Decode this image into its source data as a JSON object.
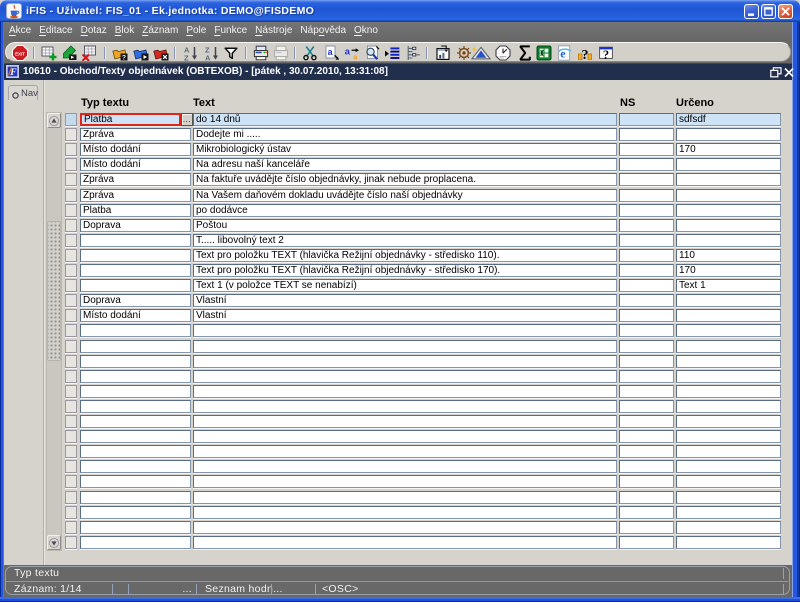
{
  "window": {
    "title": "iFIS - Uživatel: FIS_01 - Ek.jednotka: DEMO@FISDEMO",
    "controls": [
      "minimize",
      "maximize",
      "close"
    ]
  },
  "menu": {
    "items": [
      {
        "pre": "",
        "key": "A",
        "post": "kce"
      },
      {
        "pre": "",
        "key": "E",
        "post": "ditace"
      },
      {
        "pre": "",
        "key": "D",
        "post": "otaz"
      },
      {
        "pre": "",
        "key": "B",
        "post": "lok"
      },
      {
        "pre": "",
        "key": "Z",
        "post": "áznam"
      },
      {
        "pre": "",
        "key": "P",
        "post": "ole"
      },
      {
        "pre": "",
        "key": "F",
        "post": "unkce"
      },
      {
        "pre": "",
        "key": "N",
        "post": "ástroje"
      },
      {
        "pre": "Náp",
        "key": "o",
        "post": "věda"
      },
      {
        "pre": "",
        "key": "O",
        "post": "kno"
      }
    ]
  },
  "toolbar": {
    "exit_label": "EXIT",
    "icons": [
      "exit",
      "separator",
      "new-record",
      "save-record",
      "delete-record",
      "separator",
      "enter-query",
      "execute-query",
      "cancel-query",
      "separator",
      "sort-ascending",
      "sort-descending",
      "filter",
      "separator",
      "print",
      "print-preview",
      "separator",
      "cut",
      "copy",
      "paste",
      "find",
      "list-of-values",
      "tree",
      "separator",
      "window-navigator",
      "helm",
      "mountain",
      "clock",
      "sum",
      "excel-export",
      "web-browser",
      "item-help",
      "help"
    ]
  },
  "document_window": {
    "title": "10610 - Obchod/Texty objednávek (OBTEXOB) - [pátek , 30.07.2010, 13:31:08]",
    "controls": [
      "restore",
      "close"
    ]
  },
  "nav_tab": {
    "label": "Nav"
  },
  "table": {
    "columns": [
      "Typ textu",
      "Text",
      "NS",
      "Určeno"
    ],
    "lov_button_label": "...",
    "rows": [
      {
        "typ_textu": "Platba",
        "text": "do 14 dnů",
        "ns": "",
        "urceno": "sdfsdf"
      },
      {
        "typ_textu": "Zpráva",
        "text": "Dodejte mi .....",
        "ns": "",
        "urceno": ""
      },
      {
        "typ_textu": "Místo dodání",
        "text": "Mikrobiologický ústav",
        "ns": "",
        "urceno": "170"
      },
      {
        "typ_textu": "Místo dodání",
        "text": "Na adresu naší kanceláře",
        "ns": "",
        "urceno": ""
      },
      {
        "typ_textu": "Zpráva",
        "text": "Na faktuře uvádějte číslo objednávky, jinak nebude proplacena.",
        "ns": "",
        "urceno": ""
      },
      {
        "typ_textu": "Zpráva",
        "text": "Na Vašem daňovém dokladu uvádějte číslo naší objednávky",
        "ns": "",
        "urceno": ""
      },
      {
        "typ_textu": "Platba",
        "text": "po dodávce",
        "ns": "",
        "urceno": ""
      },
      {
        "typ_textu": "Doprava",
        "text": "Poštou",
        "ns": "",
        "urceno": ""
      },
      {
        "typ_textu": "",
        "text": "T..... libovolný text 2",
        "ns": "",
        "urceno": ""
      },
      {
        "typ_textu": "",
        "text": "Text pro položku TEXT (hlavička Režijní objednávky - středisko 110).",
        "ns": "",
        "urceno": "110"
      },
      {
        "typ_textu": "",
        "text": "Text pro položku TEXT (hlavička Režijní objednávky - středisko 170).",
        "ns": "",
        "urceno": "170"
      },
      {
        "typ_textu": "",
        "text": "Text 1 (v položce TEXT se nenabízí)",
        "ns": "",
        "urceno": "Text 1"
      },
      {
        "typ_textu": "Doprava",
        "text": "Vlastní",
        "ns": "",
        "urceno": ""
      },
      {
        "typ_textu": "Místo dodání",
        "text": "Vlastní",
        "ns": "",
        "urceno": ""
      }
    ],
    "empty_row_count": 15,
    "current_row_index": 0
  },
  "status_bar": {
    "message": "Typ textu",
    "record": "Záznam: 1/14",
    "ellipsis": "...",
    "list_of_values": "Seznam hodn...",
    "osc": "<OSC>"
  },
  "colors": {
    "titlebar_blue": "#2560dc",
    "menubar_gray": "#6b6b6b",
    "mdi_navy": "#212e4c",
    "canvas_gray": "#d6d3cc",
    "current_row_blue": "#cfe3f6",
    "focus_border_red": "#e1251b",
    "field_border": "#5f7390",
    "status_gray": "#686868"
  }
}
